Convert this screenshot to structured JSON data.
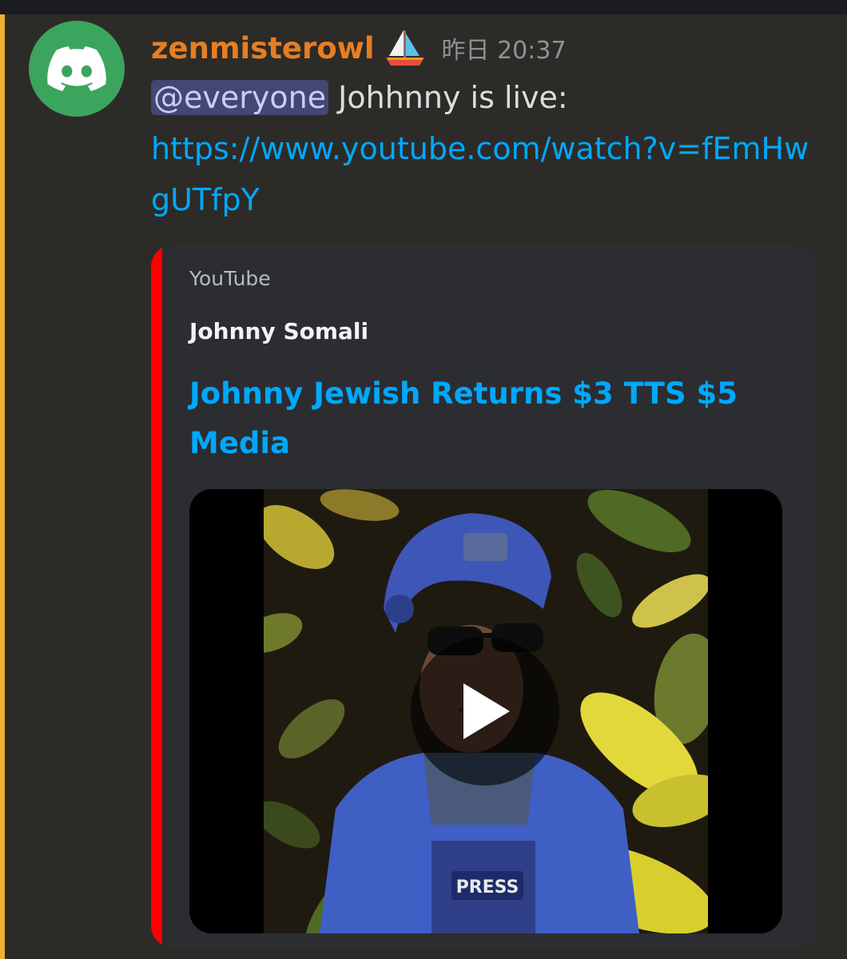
{
  "message": {
    "username": "zenmisterowl",
    "username_color": "#e67e22",
    "badge_icon": "sailboat-icon",
    "timestamp": "昨日 20:37",
    "mention": "@everyone",
    "text": " Johhnny is live:",
    "link_text": "https://www.youtube.com/watch?v=fEmHwgUTfpY",
    "mention_highlight_color": "#f0b132"
  },
  "embed": {
    "provider": "YouTube",
    "author": "Johnny Somali",
    "title": "Johnny Jewish Returns $3 TTS $5 Media",
    "accent_color": "#ff0000",
    "link_color": "#00a8fc",
    "thumbnail_label": "PRESS",
    "play_icon": "play-icon"
  }
}
